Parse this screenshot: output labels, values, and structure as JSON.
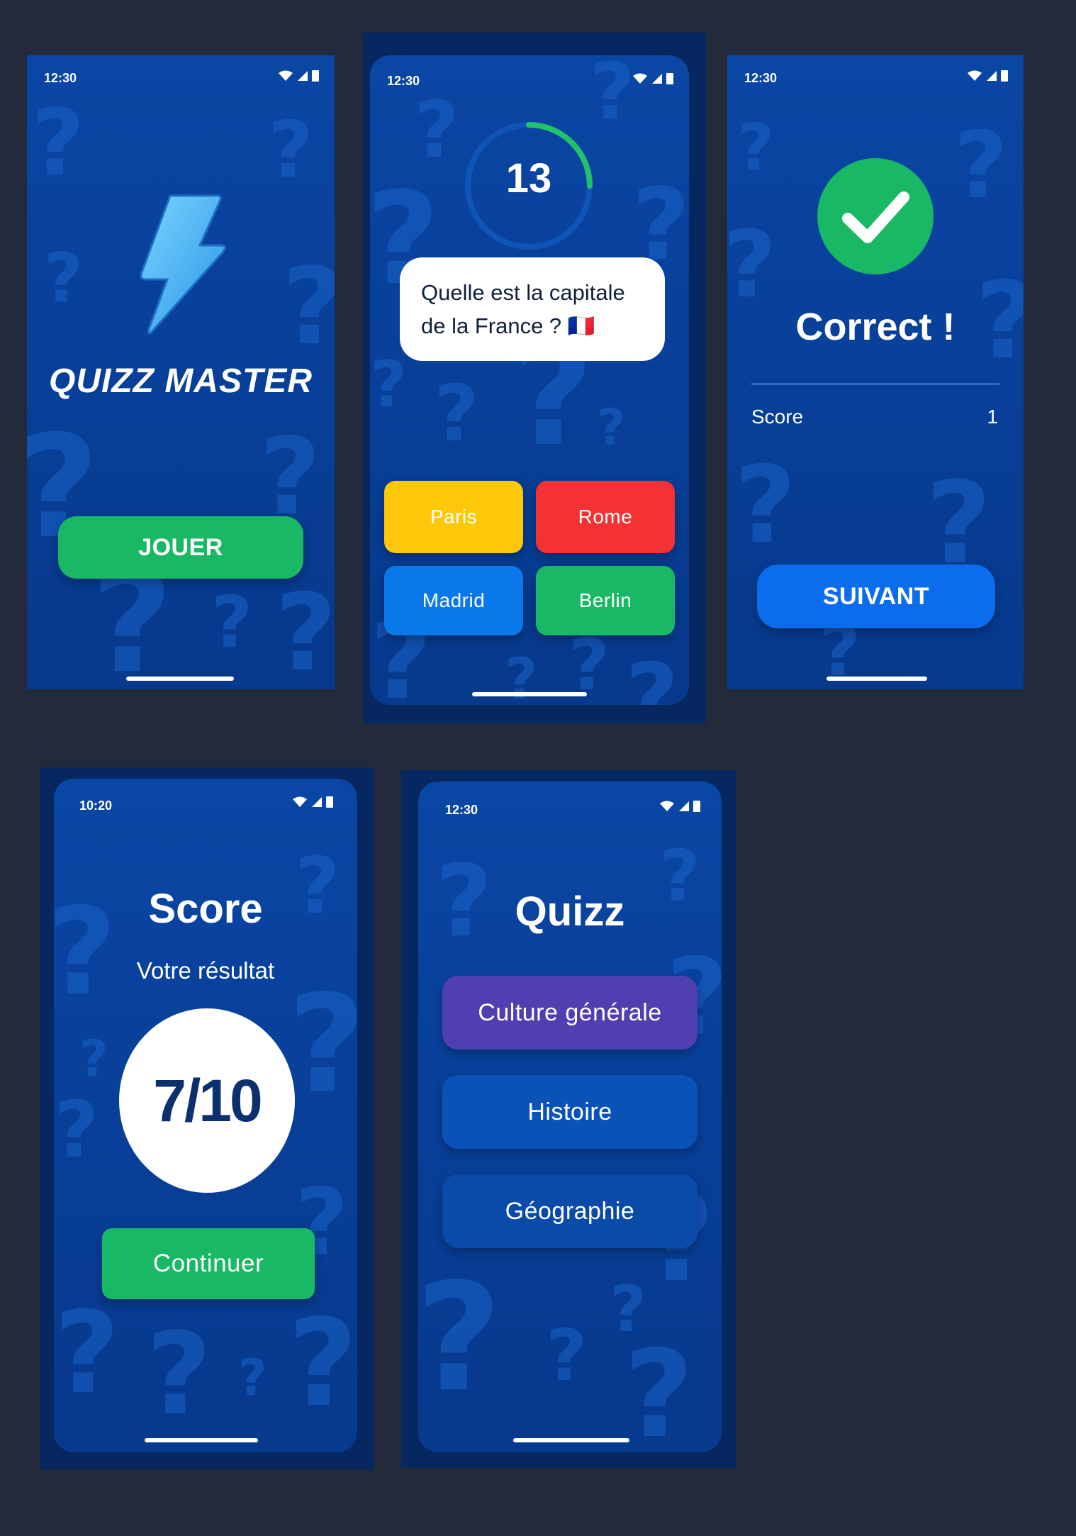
{
  "screens": {
    "home": {
      "time": "12:30",
      "title": "QUIZZ MASTER",
      "play_button": "JOUER",
      "icon": "lightning-icon"
    },
    "question": {
      "time": "12:30",
      "timer_value": "13",
      "question_text": "Quelle est la capitale de la France ? 🇫🇷",
      "answers": [
        {
          "label": "Paris",
          "color": "#fec80a"
        },
        {
          "label": "Rome",
          "color": "#f53233"
        },
        {
          "label": "Madrid",
          "color": "#0b78ea"
        },
        {
          "label": "Berlin",
          "color": "#18b864"
        }
      ]
    },
    "correct": {
      "time": "12:30",
      "title": "Correct !",
      "score_label": "Score",
      "score_value": "1",
      "next_button": "SUIVANT",
      "icon": "check-icon"
    },
    "score": {
      "time": "10:20",
      "title": "Score",
      "subtitle": "Votre résultat",
      "result": "7/10",
      "continue_button": "Continuer"
    },
    "categories": {
      "time": "12:30",
      "title": "Quizz",
      "items": [
        {
          "label": "Culture générale"
        },
        {
          "label": "Histoire"
        },
        {
          "label": "Géographie"
        }
      ]
    }
  },
  "colors": {
    "background": "#232a3b",
    "green": "#18b864",
    "blue": "#0b6ded",
    "purple": "#4f3fb0"
  }
}
